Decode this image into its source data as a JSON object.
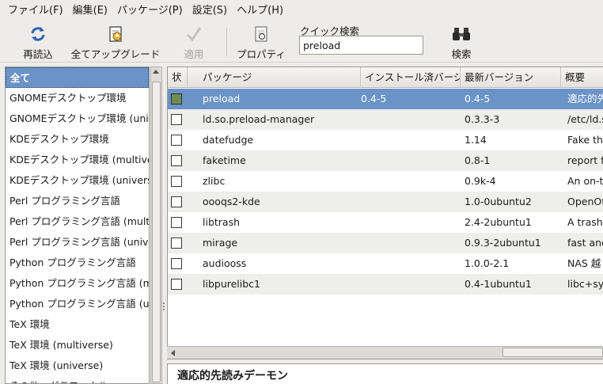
{
  "menubar": {
    "items": [
      "ファイル(F)",
      "編集(E)",
      "パッケージ(P)",
      "設定(S)",
      "ヘルプ(H)"
    ]
  },
  "toolbar": {
    "reload_label": "再読込",
    "upgrade_all_label": "全てアップグレード",
    "apply_label": "適用",
    "properties_label": "プロパティ",
    "quick_search_label": "クイック検索",
    "quick_search_value": "preload",
    "search_label": "検索"
  },
  "sidebar": {
    "items": [
      "全て",
      "GNOMEデスクトップ環境",
      "GNOMEデスクトップ環境 (universe)",
      "KDEデスクトップ環境",
      "KDEデスクトップ環境 (multiverse)",
      "KDEデスクトップ環境 (universe)",
      "Perl プログラミング言語",
      "Perl プログラミング言語 (multiverse)",
      "Perl プログラミング言語 (universe)",
      "Python プログラミング言語",
      "Python プログラミング言語 (multiverse)",
      "Python プログラミング言語 (universe)",
      "TeX 環境",
      "TeX 環境 (multiverse)",
      "TeX 環境 (universe)",
      "その他 - グラフィカル"
    ],
    "selected_index": 0
  },
  "table": {
    "columns": [
      "状",
      "パッケージ",
      "インストール済バージョン",
      "最新バージョン",
      "概要"
    ],
    "rows": [
      {
        "name": "preload",
        "installed": "0.4-5",
        "latest": "0.4-5",
        "summary": "適応的先読みデーモン",
        "is_installed": true
      },
      {
        "name": "ld.so.preload-manager",
        "installed": "",
        "latest": "0.3.3-3",
        "summary": "/etc/ld.so.preload manager",
        "is_installed": false
      },
      {
        "name": "datefudge",
        "installed": "",
        "latest": "1.14",
        "summary": "Fake the system date",
        "is_installed": false
      },
      {
        "name": "faketime",
        "installed": "",
        "latest": "0.8-1",
        "summary": "report faked system time",
        "is_installed": false
      },
      {
        "name": "zlibc",
        "installed": "",
        "latest": "0.9k-4",
        "summary": "An on-the-fly",
        "is_installed": false
      },
      {
        "name": "oooqs2-kde",
        "installed": "",
        "latest": "1.0-0ubuntu2",
        "summary": "OpenOffice",
        "is_installed": false
      },
      {
        "name": "libtrash",
        "installed": "",
        "latest": "2.4-2ubuntu1",
        "summary": "A trash can",
        "is_installed": false
      },
      {
        "name": "mirage",
        "installed": "",
        "latest": "0.9.3-2ubuntu1",
        "summary": "fast and simple",
        "is_installed": false
      },
      {
        "name": "audiooss",
        "installed": "",
        "latest": "1.0.0-2.1",
        "summary": "NAS 越しの",
        "is_installed": false
      },
      {
        "name": "libpurelibc1",
        "installed": "",
        "latest": "0.4-1ubuntu1",
        "summary": "libc+syscall",
        "is_installed": false
      }
    ],
    "selected_index": 0
  },
  "description": {
    "title": "適応的先読みデーモン"
  },
  "colors": {
    "selection": "#6b93c7",
    "installed_check": "#6f8c54"
  },
  "icons": {
    "reload": "refresh-icon",
    "upgrade": "upgrade-document-icon",
    "apply": "check-icon",
    "properties": "properties-icon",
    "search": "binoculars-icon"
  }
}
